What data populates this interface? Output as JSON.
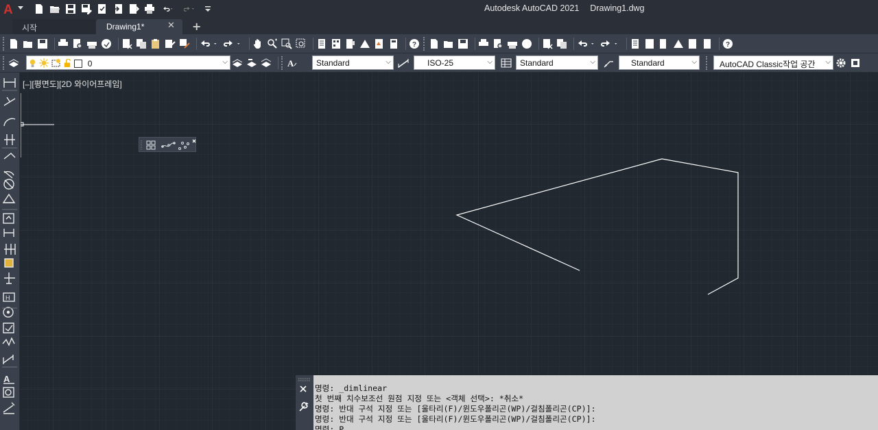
{
  "app": {
    "name": "Autodesk AutoCAD 2021",
    "file": "Drawing1.dwg",
    "logo_letter": "A"
  },
  "quick_access": {
    "icons": [
      "new-icon",
      "open-icon",
      "save-icon",
      "save-as-icon",
      "plot-publish-icon",
      "import-icon",
      "export-icon",
      "print-icon",
      "undo-icon",
      "redo-icon",
      "customize-icon"
    ]
  },
  "tabs": {
    "start_label": "시작",
    "drawing_label": "Drawing1*",
    "close_glyph": "✕",
    "add_glyph": "+"
  },
  "layer": {
    "current": "0"
  },
  "styles": {
    "text_style": "Standard",
    "dim_style": "ISO-25",
    "table_style": "Standard",
    "mleader_style": "Standard",
    "workspace": "AutoCAD Classic작업 공간"
  },
  "viewport": {
    "label": "[–][평면도][2D 와이어프레임]"
  },
  "command_history": [
    "명령: _dimlinear",
    "첫 번째 치수보조선 원점 지정 또는 <객체 선택>: *취소*",
    "명령: 반대 구석 지정 또는 [울타리(F)/윈도우폴리곤(WP)/걸침폴리곤(CP)]:",
    "명령: 반대 구석 지정 또는 [울타리(F)/윈도우폴리곤(WP)/걸침폴리곤(CP)]:",
    "명령: P"
  ],
  "colors": {
    "background": "#212830",
    "toolbar": "#3b414c",
    "grid_minor": "#293039",
    "grid_major": "#323a45",
    "logo_red": "#d0322d",
    "command_bg": "#d1d1d1"
  }
}
